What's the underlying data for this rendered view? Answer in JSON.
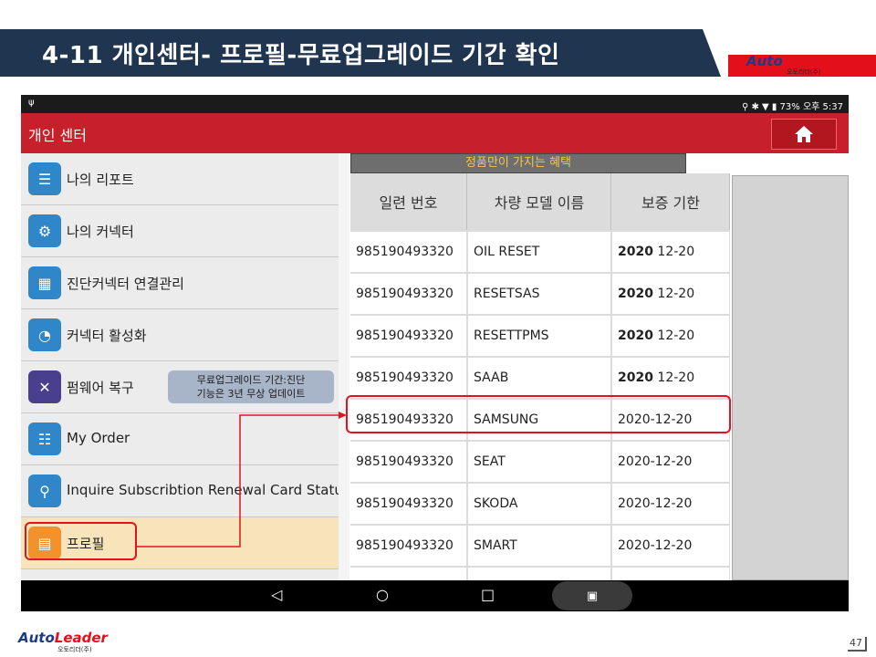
{
  "slide": {
    "title": "4-11 개인센터- 프로필-무료업그레이드 기간 확인",
    "logo_main_a": "Auto",
    "logo_main_b": "Leader",
    "logo_sub": "오토리더(주)",
    "page_number": "47"
  },
  "status_bar": {
    "usb": "ψ",
    "right": "⚲ ✱ ▼ ▮ 73% 오후 5:37"
  },
  "app_bar": {
    "title": "개인 센터",
    "home_icon": "home-icon"
  },
  "sidebar": {
    "items": [
      {
        "label": "나의 리포트",
        "icon": "report-icon"
      },
      {
        "label": "나의 커넥터",
        "icon": "connector-icon"
      },
      {
        "label": "진단커넥터 연결관리",
        "icon": "connector-manage-icon"
      },
      {
        "label": "커넥터 활성화",
        "icon": "gauge-icon"
      },
      {
        "label": "펌웨어 복구",
        "icon": "tools-icon"
      },
      {
        "label": "My Order",
        "icon": "order-icon"
      },
      {
        "label": "Inquire Subscribtion Renewal Card Status",
        "icon": "search-icon"
      },
      {
        "label": "프로필",
        "icon": "profile-card-icon"
      }
    ]
  },
  "tooltip": {
    "line1": "무료업그레이드 기간:진단",
    "line2": "기능은 3년 무상 업데이트"
  },
  "table": {
    "banner": "정품만이 가지는 혜택",
    "headers": [
      "일련 번호",
      "차량 모델 이름",
      "보증 기한"
    ],
    "rows": [
      {
        "serial": "985190493320",
        "model": "OIL RESET",
        "year": "2020",
        "rest": " 12-20"
      },
      {
        "serial": "985190493320",
        "model": "RESETSAS",
        "year": "2020",
        "rest": " 12-20"
      },
      {
        "serial": "985190493320",
        "model": "RESETTPMS",
        "year": "2020",
        "rest": " 12-20"
      },
      {
        "serial": "985190493320",
        "model": "SAAB",
        "year": "2020",
        "rest": " 12-20"
      },
      {
        "serial": "985190493320",
        "model": "SAMSUNG",
        "year": "",
        "rest": "2020-12-20"
      },
      {
        "serial": "985190493320",
        "model": "SEAT",
        "year": "",
        "rest": "2020-12-20"
      },
      {
        "serial": "985190493320",
        "model": "SKODA",
        "year": "",
        "rest": "2020-12-20"
      },
      {
        "serial": "985190493320",
        "model": "SMART",
        "year": "",
        "rest": "2020-12-20"
      }
    ]
  },
  "nav": {
    "back": "◁",
    "home": "○",
    "recents": "□",
    "gallery": "▣"
  }
}
